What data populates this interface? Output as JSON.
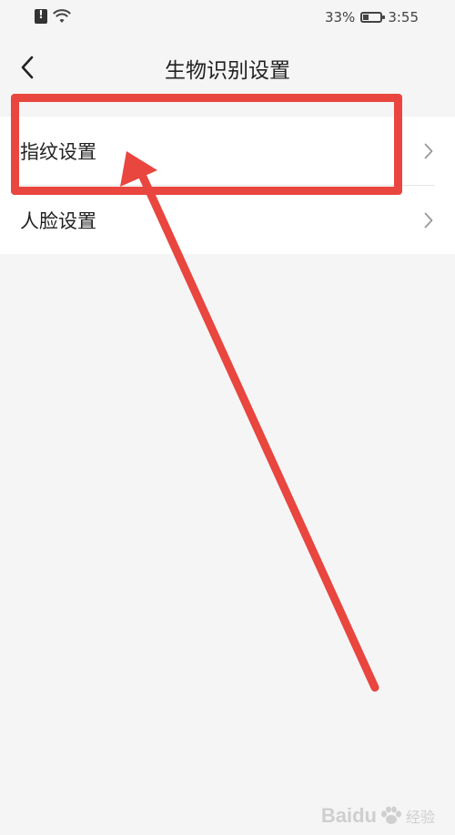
{
  "status_bar": {
    "battery_percent": "33%",
    "time": "3:55",
    "battery_level": 0.33
  },
  "header": {
    "title": "生物识别设置",
    "back_icon": "chevron-left-icon"
  },
  "list": {
    "items": [
      {
        "label": "指纹设置",
        "icon": "chevron-right-icon"
      },
      {
        "label": "人脸设置",
        "icon": "chevron-right-icon"
      }
    ]
  },
  "annotation": {
    "color": "#e8463f"
  },
  "watermark": {
    "brand": "Baidu",
    "suffix": "经验"
  }
}
